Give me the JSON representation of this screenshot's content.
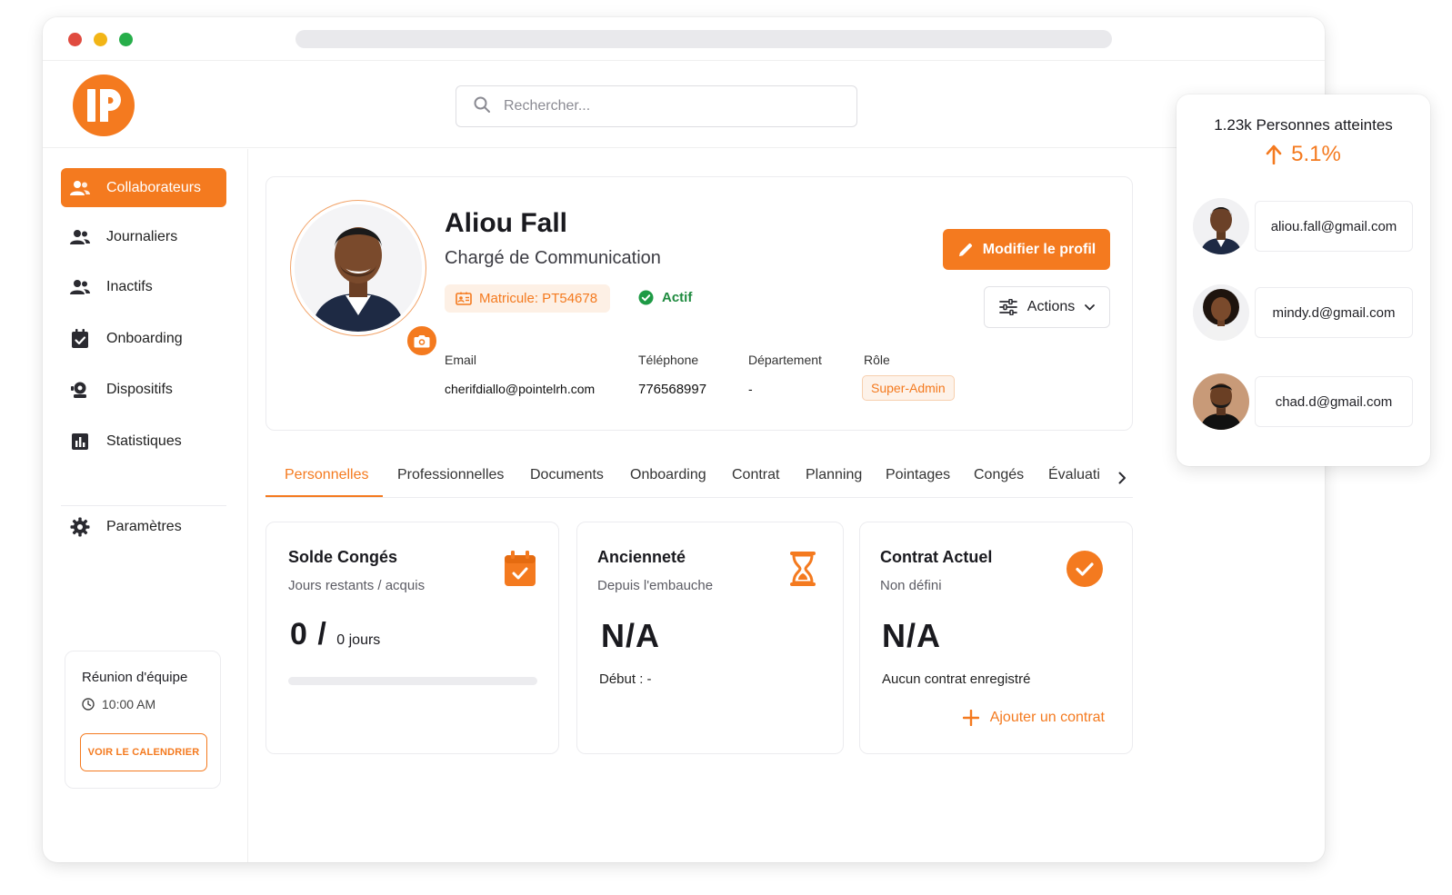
{
  "colors": {
    "accent": "#f47a1f",
    "success": "#1e8a3e",
    "accent_soft": "#fdf0e5"
  },
  "search": {
    "placeholder": "Rechercher..."
  },
  "sidebar": {
    "items": [
      {
        "label": "Collaborateurs",
        "icon": "users-icon"
      },
      {
        "label": "Journaliers",
        "icon": "users-icon"
      },
      {
        "label": "Inactifs",
        "icon": "users-icon"
      },
      {
        "label": "Onboarding",
        "icon": "calendar-check-icon"
      },
      {
        "label": "Dispositifs",
        "icon": "device-icon"
      },
      {
        "label": "Statistiques",
        "icon": "bar-chart-icon"
      },
      {
        "label": "Paramètres",
        "icon": "gear-icon"
      }
    ],
    "meeting": {
      "title": "Réunion d'équipe",
      "time": "10:00 AM",
      "button": "VOIR LE CALENDRIER"
    }
  },
  "profile": {
    "name": "Aliou Fall",
    "job_title": "Chargé de Communication",
    "matricule": "Matricule: PT54678",
    "status": "Actif",
    "edit_button": "Modifier le profil",
    "actions_button": "Actions",
    "fields": {
      "email_label": "Email",
      "email_value": "cherifdiallo@pointelrh.com",
      "phone_label": "Téléphone",
      "phone_value": "776568997",
      "dept_label": "Département",
      "dept_value": "-",
      "role_label": "Rôle",
      "role_value": "Super-Admin"
    }
  },
  "tabs": [
    "Personnelles",
    "Professionnelles",
    "Documents",
    "Onboarding",
    "Contrat",
    "Planning",
    "Pointages",
    "Congés",
    "Évaluati"
  ],
  "cards": {
    "leave": {
      "title": "Solde Congés",
      "subtitle": "Jours restants / acquis",
      "value": "0 /",
      "unit": "0 jours",
      "progress": 0
    },
    "seniority": {
      "title": "Ancienneté",
      "subtitle": "Depuis l'embauche",
      "value": "N/A",
      "start": "Début : -"
    },
    "contract": {
      "title": "Contrat Actuel",
      "subtitle": "Non défini",
      "value": "N/A",
      "note": "Aucun contrat enregistré",
      "add": "Ajouter un contrat"
    }
  },
  "reach": {
    "title": "1.23k Personnes atteintes",
    "growth": "5.1%",
    "contacts": [
      {
        "email": "aliou.fall@gmail.com"
      },
      {
        "email": "mindy.d@gmail.com"
      },
      {
        "email": "chad.d@gmail.com"
      }
    ]
  }
}
